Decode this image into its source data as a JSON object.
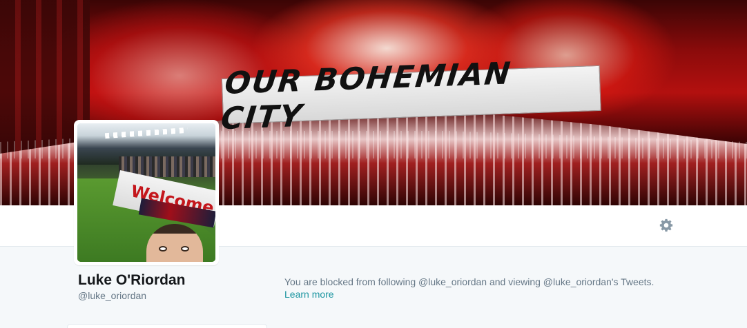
{
  "header": {
    "banner_image": "header-photo",
    "banner_text": "OUR BOHEMIAN CITY"
  },
  "toolbar": {
    "settings_icon": "gear-icon"
  },
  "avatar": {
    "image": "profile-photo",
    "sign_text": "Welcome"
  },
  "profile": {
    "name": "Luke O'Riordan",
    "handle": "@luke_oriordan"
  },
  "notice": {
    "message": "You are blocked from following @luke_oriordan and viewing @luke_oriordan's Tweets.",
    "link_label": "Learn more"
  },
  "colors": {
    "accent": "#1b95a0",
    "name": "#14171a",
    "muted": "#657786",
    "background": "#f5f8fa"
  }
}
